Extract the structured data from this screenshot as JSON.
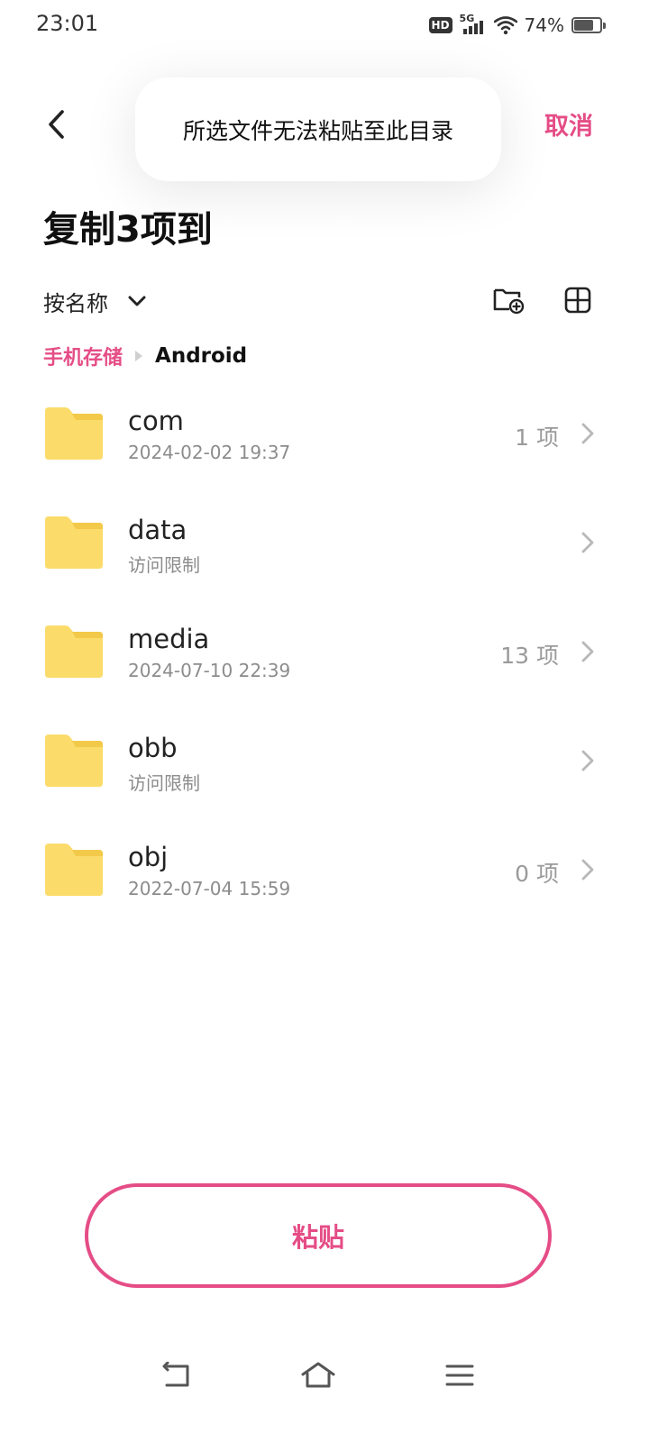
{
  "status_bar": {
    "time": "23:01",
    "hd_badge": "HD",
    "network": "5G",
    "battery_percent": "74%",
    "battery_level": 0.74
  },
  "header": {
    "title": "复制3项到",
    "cancel_label": "取消",
    "toast_message": "所选文件无法粘贴至此目录"
  },
  "toolbar": {
    "sort_label": "按名称"
  },
  "breadcrumb": {
    "root": "手机存储",
    "current": "Android"
  },
  "files": [
    {
      "name": "com",
      "sub": "2024-02-02 19:37",
      "count": "1 项"
    },
    {
      "name": "data",
      "sub": "访问限制",
      "count": ""
    },
    {
      "name": "media",
      "sub": "2024-07-10 22:39",
      "count": "13 项"
    },
    {
      "name": "obb",
      "sub": "访问限制",
      "count": ""
    },
    {
      "name": "obj",
      "sub": "2022-07-04 15:59",
      "count": "0 项"
    }
  ],
  "actions": {
    "paste_label": "粘贴"
  },
  "colors": {
    "accent": "#e54d86",
    "folder": "#fbdc6b",
    "folder_tab": "#f3c94a"
  },
  "icons": {
    "back": "chevron-left-icon",
    "sort": "chevron-down-icon",
    "new_folder": "new-folder-icon",
    "grid": "grid-view-icon",
    "folder": "folder-icon",
    "row_chevron": "chevron-right-icon",
    "nav_back": "nav-back-icon",
    "nav_home": "nav-home-icon",
    "nav_menu": "nav-menu-icon"
  }
}
